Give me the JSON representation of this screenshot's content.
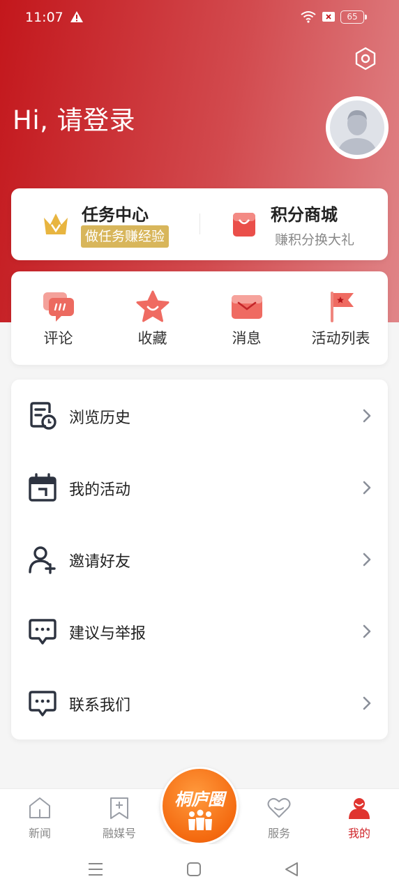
{
  "status": {
    "time": "11:07",
    "battery": "65"
  },
  "header": {
    "greeting": "Hi, 请登录"
  },
  "task_card": {
    "task_title": "任务中心",
    "task_badge": "做任务赚经验",
    "shop_title": "积分商城",
    "shop_subtitle": "赚积分换大礼"
  },
  "shortcuts": [
    {
      "label": "评论",
      "icon": "comment-icon"
    },
    {
      "label": "收藏",
      "icon": "star-icon"
    },
    {
      "label": "消息",
      "icon": "mail-icon"
    },
    {
      "label": "活动列表",
      "icon": "flag-icon"
    }
  ],
  "menu": [
    {
      "label": "浏览历史",
      "icon": "history-icon"
    },
    {
      "label": "我的活动",
      "icon": "calendar-icon"
    },
    {
      "label": "邀请好友",
      "icon": "add-user-icon"
    },
    {
      "label": "建议与举报",
      "icon": "feedback-icon"
    },
    {
      "label": "联系我们",
      "icon": "chat-icon"
    }
  ],
  "tabs": [
    {
      "label": "新闻",
      "icon": "home-icon"
    },
    {
      "label": "融媒号",
      "icon": "bookmark-icon"
    },
    {
      "label": "桐庐圈",
      "icon": "people-icon"
    },
    {
      "label": "服务",
      "icon": "heart-icon"
    },
    {
      "label": "我的",
      "icon": "profile-icon"
    }
  ],
  "colors": {
    "brand_red": "#c3171c",
    "active_tab": "#d0262b",
    "center_orange": "#f46a10",
    "badge_gold": "#d8b65b"
  }
}
